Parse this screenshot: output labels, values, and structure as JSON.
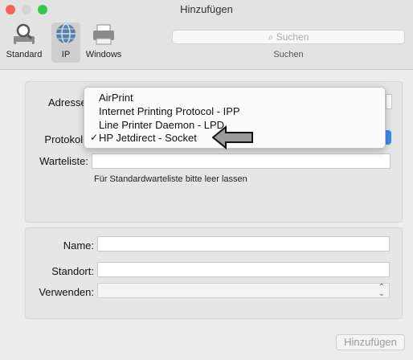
{
  "window": {
    "title": "Hinzufügen"
  },
  "toolbar": {
    "tools": [
      {
        "label": "Standard",
        "icon": "magnifier-printer-icon"
      },
      {
        "label": "IP",
        "icon": "globe-icon",
        "selected": true
      },
      {
        "label": "Windows",
        "icon": "windows-printer-icon"
      }
    ],
    "search": {
      "placeholder": "Suchen",
      "label": "Suchen"
    }
  },
  "form": {
    "address_label": "Adresse",
    "protocol_label": "Protokoll",
    "queue_label": "Warteliste:",
    "queue_hint": "Für Standardwarteliste bitte leer lassen",
    "name_label": "Name:",
    "location_label": "Standort:",
    "use_label": "Verwenden:"
  },
  "protocol_menu": {
    "options": [
      {
        "label": "AirPrint",
        "checked": false
      },
      {
        "label": "Internet Printing Protocol - IPP",
        "checked": false
      },
      {
        "label": "Line Printer Daemon - LPD",
        "checked": false
      },
      {
        "label": "HP Jetdirect - Socket",
        "checked": true
      }
    ],
    "check_mark": "✓"
  },
  "buttons": {
    "add": "Hinzufügen"
  },
  "colors": {
    "accent": "#3b8cf0",
    "close": "#fc605c",
    "minimize": "#d9d9d9",
    "zoom": "#34c84a"
  }
}
